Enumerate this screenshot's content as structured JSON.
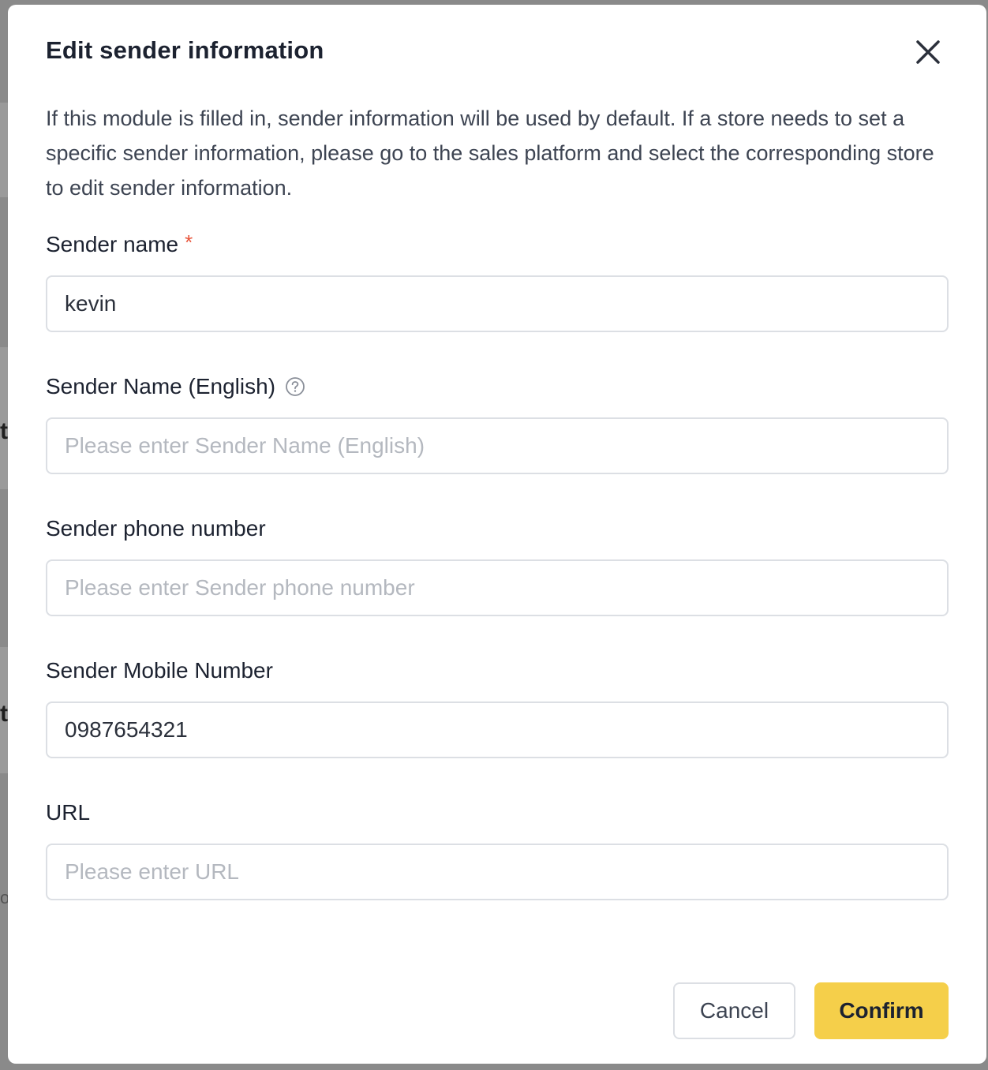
{
  "backdrop": {
    "fragments": [
      "t",
      "t",
      "o"
    ]
  },
  "modal": {
    "title": "Edit sender information",
    "close_icon": "close-icon",
    "intro": "If this module is filled in, sender information will be used by default. If a store needs to set a specific sender information, please go to the sales platform and select the corresponding store to edit sender information."
  },
  "fields": {
    "sender_name": {
      "label": "Sender name",
      "required_mark": "*",
      "value": "kevin",
      "placeholder": ""
    },
    "sender_name_en": {
      "label": "Sender Name (English)",
      "help_icon": "question-circle-icon",
      "value": "",
      "placeholder": "Please enter Sender Name (English)"
    },
    "sender_phone": {
      "label": "Sender phone number",
      "value": "",
      "placeholder": "Please enter Sender phone number"
    },
    "sender_mobile": {
      "label": "Sender Mobile Number",
      "value": "0987654321",
      "placeholder": ""
    },
    "url": {
      "label": "URL",
      "value": "",
      "placeholder": "Please enter URL"
    }
  },
  "footer": {
    "cancel_label": "Cancel",
    "confirm_label": "Confirm"
  },
  "colors": {
    "primary_button": "#f5cf4a",
    "required_star": "#e8543a",
    "title_text": "#1c2230",
    "border": "#dcdfe4",
    "placeholder": "#b4b8bf"
  }
}
